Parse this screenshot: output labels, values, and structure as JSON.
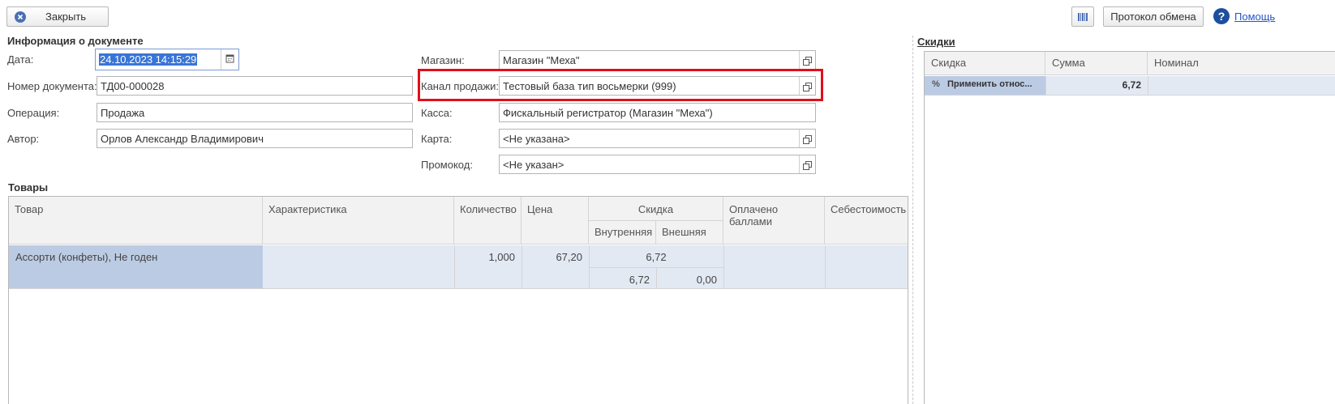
{
  "toolbar": {
    "close_label": "Закрыть",
    "protocol_label": "Протокол обмена",
    "help_label": "Помощь",
    "help_glyph": "?"
  },
  "doc_info": {
    "section_title": "Информация о документе",
    "date": {
      "label": "Дата:",
      "value": "24.10.2023 14:15:29"
    },
    "number": {
      "label": "Номер документа:",
      "value": "ТД00-000028"
    },
    "operation": {
      "label": "Операция:",
      "value": "Продажа"
    },
    "author": {
      "label": "Автор:",
      "value": "Орлов Александр Владимирович"
    },
    "store": {
      "label": "Магазин:",
      "value": "Магазин \"Меха\""
    },
    "channel": {
      "label": "Канал продажи:",
      "value": "Тестовый база тип восьмерки (999)"
    },
    "cashbox": {
      "label": "Касса:",
      "value": "Фискальный регистратор (Магазин \"Меха\")"
    },
    "card": {
      "label": "Карта:",
      "value": "<Не указана>"
    },
    "promo": {
      "label": "Промокод:",
      "value": "<Не указан>"
    }
  },
  "goods": {
    "section_title": "Товары",
    "headers": {
      "item": "Товар",
      "characteristic": "Характеристика",
      "quantity": "Количество",
      "price": "Цена",
      "discount": "Скидка",
      "internal": "Внутренняя",
      "external": "Внешняя",
      "paid_points": "Оплачено баллами",
      "cost": "Себестоимость"
    },
    "rows": [
      {
        "item": "Ассорти (конфеты), Не годен",
        "characteristic": "",
        "quantity": "1,000",
        "price": "67,20",
        "discount": "6,72",
        "internal": "6,72",
        "external": "0,00",
        "paid_points": "",
        "cost": ""
      }
    ]
  },
  "discounts": {
    "section_title": "Скидки",
    "headers": {
      "discount": "Скидка",
      "sum": "Сумма",
      "nominal": "Номинал"
    },
    "rows": [
      {
        "discount": "Применить относ...",
        "sum": "6,72",
        "nominal": ""
      }
    ]
  },
  "colors": {
    "highlight_border": "#e0101a",
    "selected_row": "#bccbe4",
    "row_bg": "#e3e9f3",
    "link": "#2457c5"
  }
}
